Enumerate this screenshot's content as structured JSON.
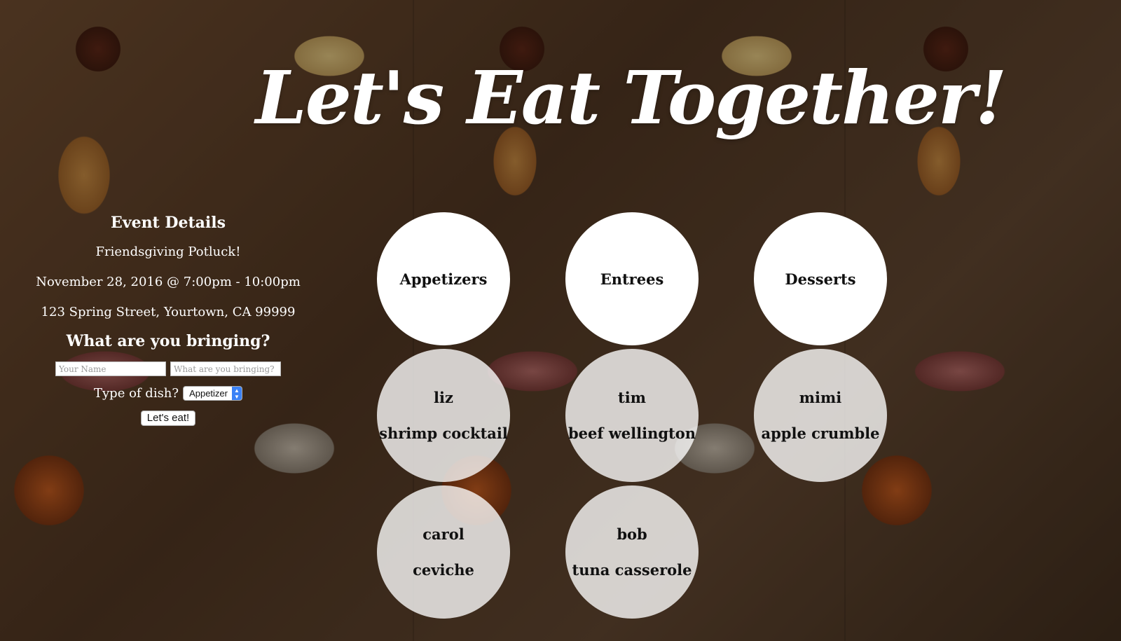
{
  "title": "Let's Eat Together!",
  "event": {
    "heading": "Event Details",
    "name": "Friendsgiving Potluck!",
    "datetime": "November 28, 2016 @ 7:00pm - 10:00pm",
    "address": "123 Spring Street, Yourtown, CA 99999"
  },
  "form": {
    "heading": "What are you bringing?",
    "name_placeholder": "Your Name",
    "dish_placeholder": "What are you bringing?",
    "type_label": "Type of dish?",
    "type_selected": "Appetizer",
    "submit_label": "Let's eat!"
  },
  "categories": [
    "Appetizers",
    "Entrees",
    "Desserts"
  ],
  "dishes": {
    "appetizers": [
      {
        "name": "liz",
        "dish": "shrimp cocktail"
      },
      {
        "name": "carol",
        "dish": "ceviche"
      }
    ],
    "entrees": [
      {
        "name": "tim",
        "dish": "beef wellington"
      },
      {
        "name": "bob",
        "dish": "tuna casserole"
      }
    ],
    "desserts": [
      {
        "name": "mimi",
        "dish": "apple crumble"
      }
    ]
  }
}
